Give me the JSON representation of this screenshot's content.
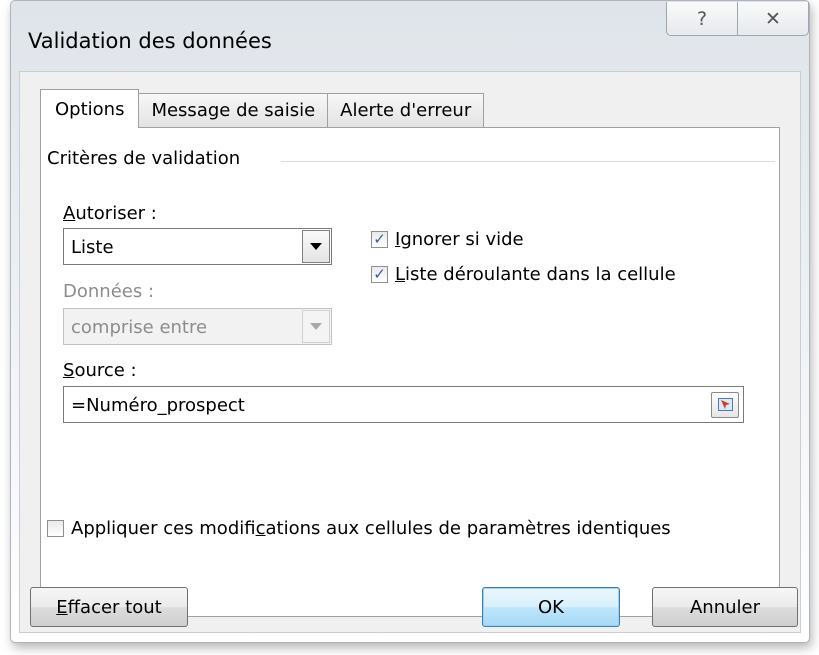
{
  "window": {
    "title": "Validation des données",
    "help_glyph": "?",
    "close_glyph": "✕"
  },
  "tabs": [
    {
      "label": "Options",
      "active": true
    },
    {
      "label": "Message de saisie",
      "active": false
    },
    {
      "label": "Alerte d'erreur",
      "active": false
    }
  ],
  "criteria": {
    "group_title": "Critères de validation",
    "allow_label_hotkey": "A",
    "allow_label_rest": "utoriser :",
    "allow_value": "Liste",
    "data_label": "Données :",
    "data_value": "comprise entre",
    "source_label_hotkey": "S",
    "source_label_rest": "ource :",
    "source_value": "=Numéro_prospect"
  },
  "checkboxes": {
    "ignore_blank": {
      "hotkey": "I",
      "rest": "gnorer si vide",
      "checked": true
    },
    "in_cell_dropdown": {
      "hotkey": "L",
      "rest": "iste déroulante dans la cellule",
      "checked": true
    },
    "apply_changes": {
      "before": "Appliquer ces modifi",
      "hotkey": "c",
      "after": "ations aux cellules de paramètres identiques",
      "checked": false
    }
  },
  "buttons": {
    "clear_hotkey": "E",
    "clear_rest": "ffacer tout",
    "ok": "OK",
    "cancel": "Annuler"
  },
  "icons": {
    "check": "✓",
    "dropdown": "chevron-down-icon",
    "collapse": "range-select-icon"
  }
}
